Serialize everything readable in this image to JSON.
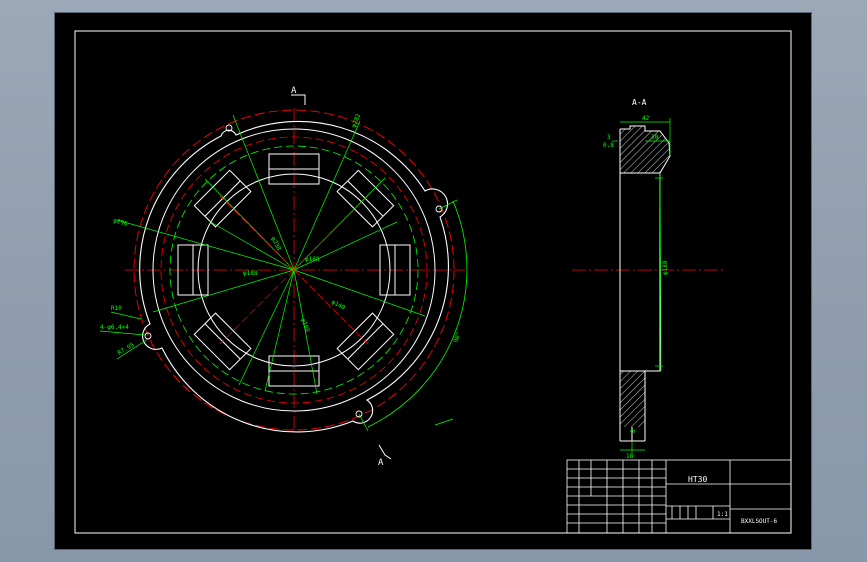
{
  "drawing": {
    "colors": {
      "background": "#000000",
      "outline": "#ffffff",
      "dimension": "#00ff00",
      "centerline": "#ff0000",
      "hatch": "#ffffff"
    },
    "section_marker_top": "A",
    "section_marker_bottom": "A",
    "section_view_label": "A-A",
    "front_view": {
      "dimensions": {
        "d_outer": "φ296",
        "d_bolt_circle": "φ282",
        "d_bore": "φ188",
        "d_inner": "φ168",
        "d_mid": "φ238",
        "d_140": "φ140",
        "d_180": "φ180",
        "r10": "R10",
        "holes": "4-φ6.4×4",
        "r_lobe": "R7.95",
        "angle": "90°"
      }
    },
    "section_view": {
      "dimensions": {
        "top_width": "42",
        "flange_width": "30",
        "step": "3",
        "face_mark": "0.8",
        "bore": "φ188",
        "bottom_small": "8",
        "bottom_width": "18"
      }
    },
    "title_block": {
      "material": "HT30",
      "scale": "1:1",
      "drawing_number": "BXXLSOUT-6"
    }
  }
}
